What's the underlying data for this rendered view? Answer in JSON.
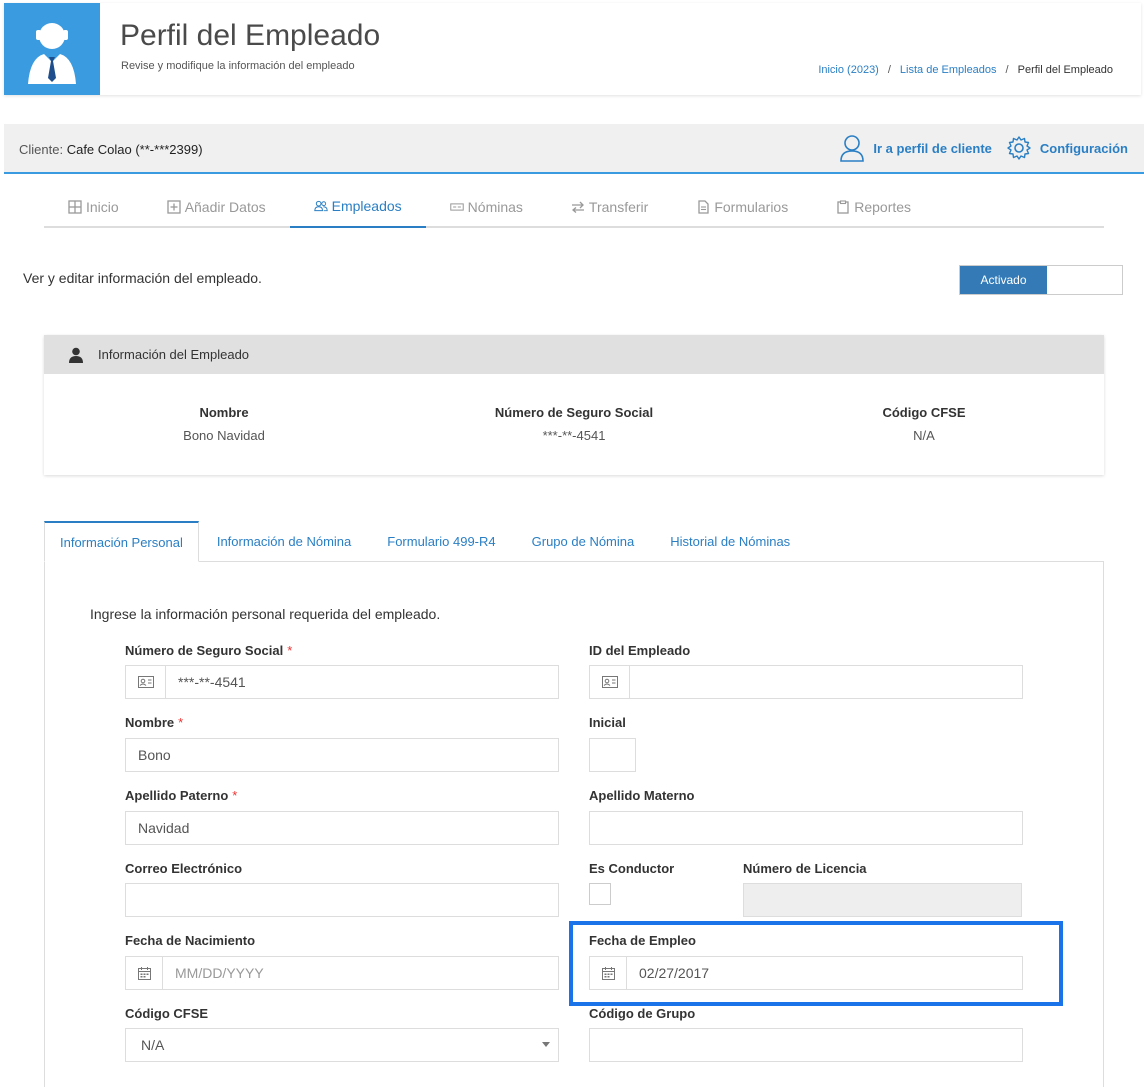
{
  "header": {
    "title": "Perfil del Empleado",
    "subtitle": "Revise y modifique la información del empleado",
    "breadcrumb": [
      "Inicio (2023)",
      "Lista de Empleados",
      "Perfil del Empleado"
    ]
  },
  "client_bar": {
    "label": "Cliente:",
    "client_name": "Cafe Colao (**-***2399)",
    "profile_link": "Ir a perfil de cliente",
    "config_link": "Configuración"
  },
  "nav": {
    "items": [
      "Inicio",
      "Añadir Datos",
      "Empleados",
      "Nóminas",
      "Transferir",
      "Formularios",
      "Reportes"
    ],
    "active": "Empleados"
  },
  "view_text": "Ver y editar información del empleado.",
  "toggle": {
    "label": "Activado"
  },
  "employee_card": {
    "title": "Información del Empleado",
    "name_label": "Nombre",
    "name_value": "Bono Navidad",
    "ssn_label": "Número de Seguro Social",
    "ssn_value": "***-**-4541",
    "cfse_label": "Código CFSE",
    "cfse_value": "N/A"
  },
  "tabs": {
    "items": [
      "Información Personal",
      "Información de Nómina",
      "Formulario 499-R4",
      "Grupo de Nómina",
      "Historial de Nóminas"
    ],
    "active": "Información Personal"
  },
  "form": {
    "intro": "Ingrese la información personal requerida del empleado.",
    "ssn": {
      "label": "Número de Seguro Social",
      "value": "***-**-4541",
      "required": "*"
    },
    "employee_id": {
      "label": "ID del Empleado",
      "value": ""
    },
    "first_name": {
      "label": "Nombre",
      "value": "Bono",
      "required": "*"
    },
    "initial": {
      "label": "Inicial",
      "value": ""
    },
    "last_name": {
      "label": "Apellido Paterno",
      "value": "Navidad",
      "required": "*"
    },
    "maternal_name": {
      "label": "Apellido Materno",
      "value": ""
    },
    "email": {
      "label": "Correo Electrónico",
      "value": ""
    },
    "driver": {
      "label": "Es Conductor"
    },
    "license": {
      "label": "Número de Licencia",
      "value": ""
    },
    "birth_date": {
      "label": "Fecha de Nacimiento",
      "placeholder": "MM/DD/YYYY"
    },
    "hire_date": {
      "label": "Fecha de Empleo",
      "value": "02/27/2017"
    },
    "cfse_code": {
      "label": "Código CFSE",
      "value": "N/A"
    },
    "group_code": {
      "label": "Código de Grupo",
      "value": ""
    }
  },
  "colors": {
    "accent": "#3a9be0",
    "link": "#2a7fc4",
    "highlight": "#1a73e8",
    "toggle_on": "#337ab7"
  }
}
